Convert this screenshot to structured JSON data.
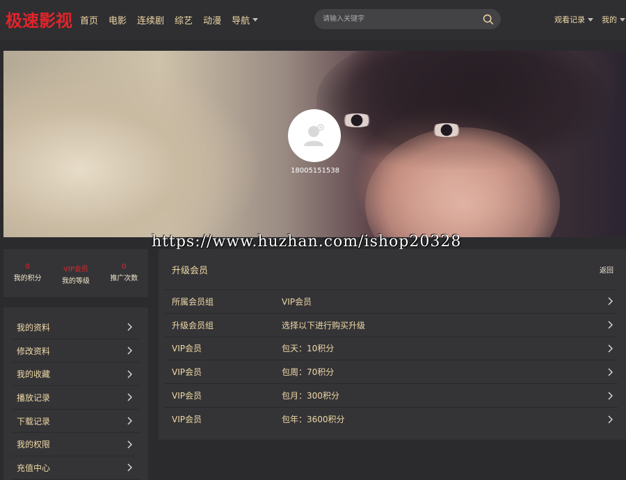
{
  "header": {
    "logo": "极速影视",
    "nav": [
      "首页",
      "电影",
      "连续剧",
      "综艺",
      "动漫",
      "导航"
    ],
    "search_placeholder": "请输入关键字",
    "watch_history": "观看记录",
    "mine": "我的"
  },
  "banner": {
    "username": "18005151538",
    "watermark": "https://www.huzhan.com/ishop20328"
  },
  "stats": [
    {
      "value": "0",
      "label": "我的积分"
    },
    {
      "value": "VIP会员",
      "label": "我的等级"
    },
    {
      "value": "0",
      "label": "推广次数"
    }
  ],
  "menu": [
    "我的资料",
    "修改资料",
    "我的收藏",
    "播放记录",
    "下载记录",
    "我的权限",
    "充值中心"
  ],
  "panel": {
    "title": "升级会员",
    "back": "返回",
    "rows": [
      {
        "label": "所属会员组",
        "value": "VIP会员"
      },
      {
        "label": "升级会员组",
        "value": "选择以下进行购买升级"
      },
      {
        "label": "VIP会员",
        "value": "包天：10积分"
      },
      {
        "label": "VIP会员",
        "value": "包周：70积分"
      },
      {
        "label": "VIP会员",
        "value": "包月：300积分"
      },
      {
        "label": "VIP会员",
        "value": "包年：3600积分"
      }
    ]
  },
  "colors": {
    "logo": "#e2242a",
    "accent_text": "#f0d9a6",
    "background": "#2b2b2e",
    "panel": "#343437"
  }
}
